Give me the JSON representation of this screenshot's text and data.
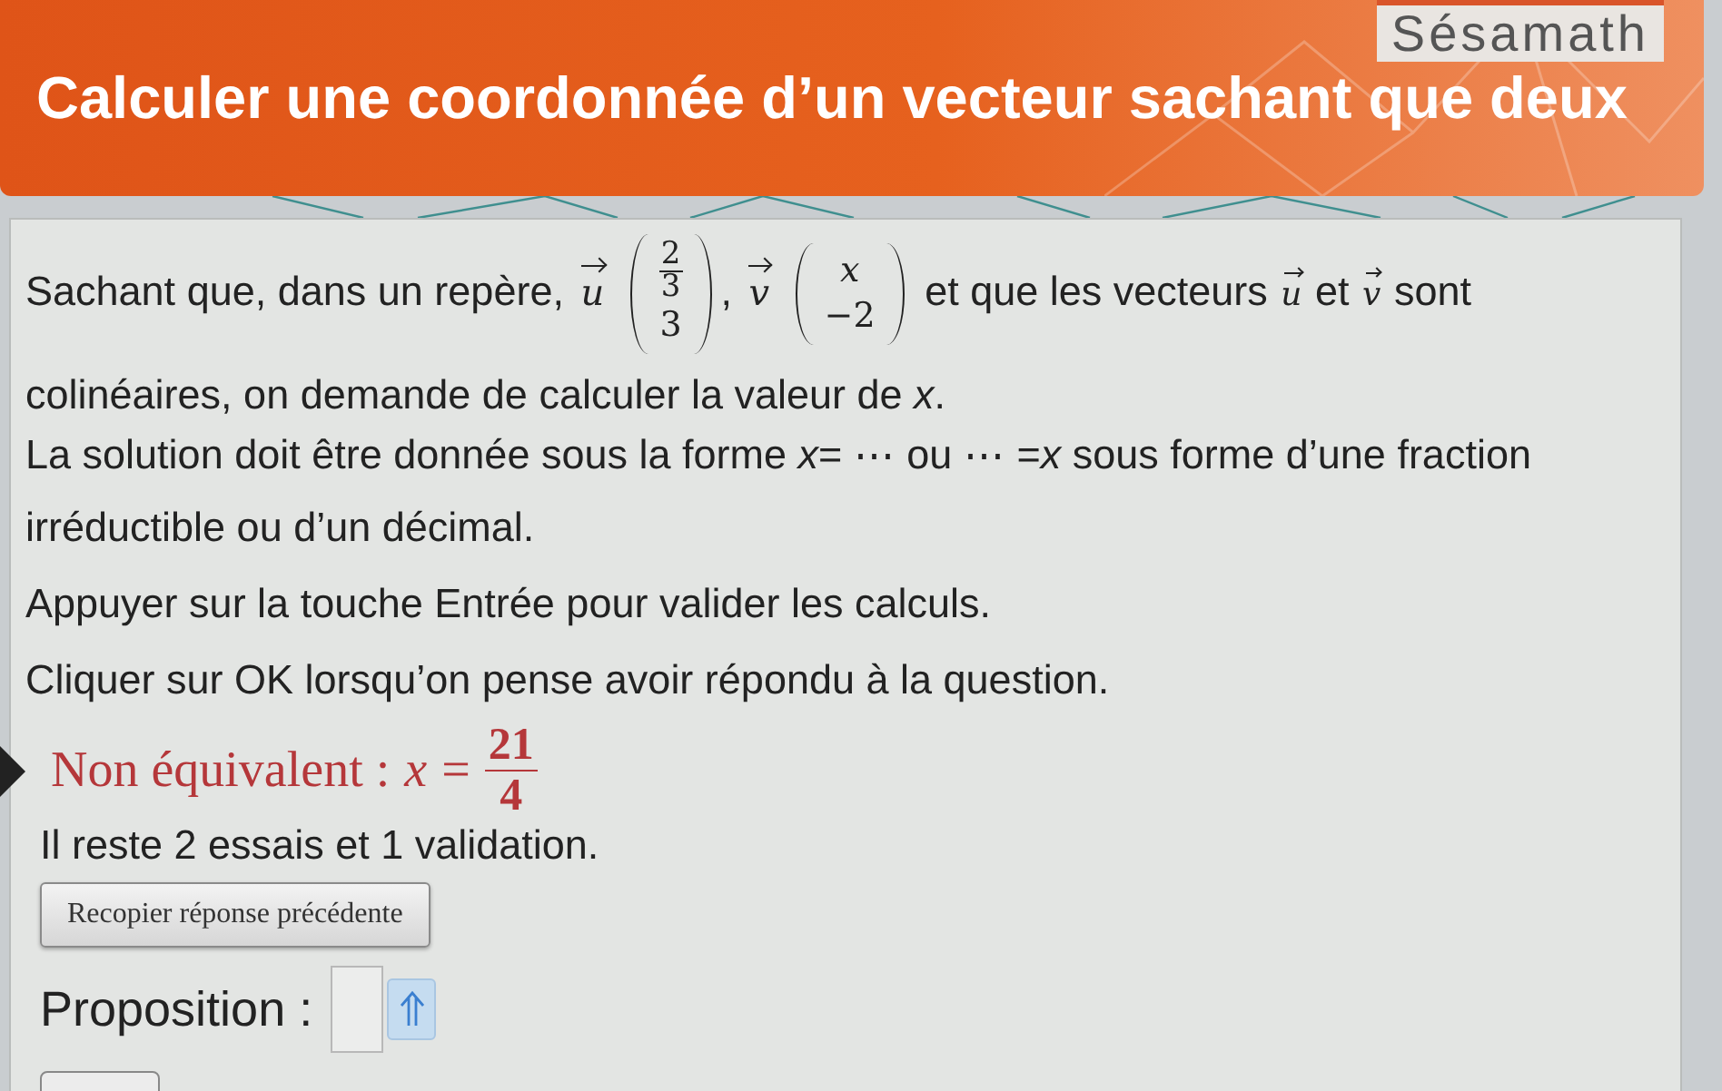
{
  "header": {
    "logo": "Sésamath",
    "title": "Calculer une coordonnée d’un vecteur sachant que deux"
  },
  "statement": [
    {
      "kind": "text",
      "text": "Sachant que, dans un repère, "
    },
    {
      "kind": "vector",
      "name": "u",
      "entries": [
        {
          "kind": "fraction",
          "num": "2",
          "den": "3"
        },
        {
          "kind": "number",
          "text": "3"
        }
      ]
    },
    {
      "kind": "text",
      "text": ", "
    },
    {
      "kind": "vector",
      "name": "v",
      "entries": [
        {
          "kind": "variable",
          "text": "x"
        },
        {
          "kind": "number",
          "text": "−2"
        }
      ]
    },
    {
      "kind": "text",
      "text": " et que les vecteurs "
    },
    {
      "kind": "vector_ref",
      "name": "u"
    },
    {
      "kind": "text",
      "text": " et "
    },
    {
      "kind": "vector_ref",
      "name": "v"
    },
    {
      "kind": "text",
      "text": " sont colinéaires, on demande de calculer la valeur de *x*."
    }
  ],
  "instructions": [
    "La solution doit être donnée sous la forme *x*= ⋯ ou ⋯ =*x* sous forme d’une fraction irréductible ou d’un décimal.",
    "Appuyer sur la touche Entrée pour valider les calculs.",
    "Cliquer sur OK lorsqu’on pense avoir répondu à la question."
  ],
  "feedback": {
    "correct": false,
    "label": "Non équivalent :",
    "variable": "x",
    "relation": "=",
    "numerator": "21",
    "denominator": "4"
  },
  "attempts_info": "Il reste 2 essais et 1 validation.",
  "copy_button": "Recopier réponse précédente",
  "answer": {
    "label": "Proposition :"
  }
}
